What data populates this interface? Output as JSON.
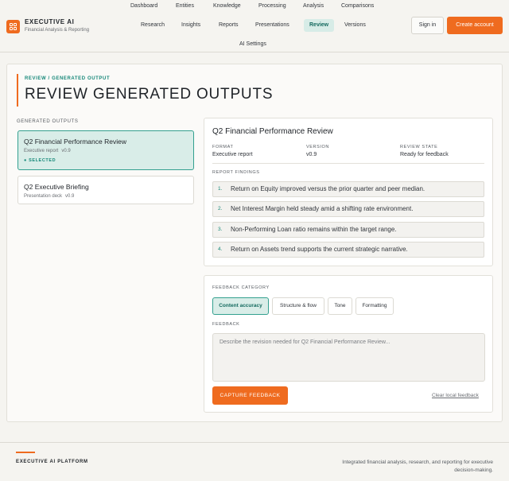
{
  "brand": {
    "name": "EXECUTIVE AI",
    "subtitle": "Financial Analysis & Reporting"
  },
  "top_nav": [
    "Dashboard",
    "Entities",
    "Knowledge",
    "Processing",
    "Analysis",
    "Comparisons"
  ],
  "main_nav": [
    "Research",
    "Insights",
    "Reports",
    "Presentations",
    "Review",
    "Versions"
  ],
  "main_nav_active": "Review",
  "settings_link": "AI Settings",
  "auth": {
    "sign_in": "Sign in",
    "create_account": "Create account"
  },
  "page": {
    "breadcrumb": "REVIEW / GENERATED OUTPUT",
    "title": "REVIEW GENERATED OUTPUTS"
  },
  "outputs": {
    "label": "GENERATED OUTPUTS",
    "items": [
      {
        "title": "Q2 Financial Performance Review",
        "type": "Executive report",
        "version": "v0.9",
        "selected_label": "SELECTED"
      },
      {
        "title": "Q2 Executive Briefing",
        "type": "Presentation deck",
        "version": "v0.9"
      }
    ]
  },
  "review": {
    "title": "Q2 Financial Performance Review",
    "meta": [
      {
        "label": "FORMAT",
        "value": "Executive report"
      },
      {
        "label": "VERSION",
        "value": "v0.9"
      },
      {
        "label": "REVIEW STATE",
        "value": "Ready for feedback"
      }
    ],
    "findings_label": "REPORT FINDINGS",
    "findings": [
      {
        "num": "1.",
        "text": "Return on Equity improved versus the prior quarter and peer median."
      },
      {
        "num": "2.",
        "text": "Net Interest Margin held steady amid a shifting rate environment."
      },
      {
        "num": "3.",
        "text": "Non-Performing Loan ratio remains within the target range."
      },
      {
        "num": "4.",
        "text": "Return on Assets trend supports the current strategic narrative."
      }
    ]
  },
  "feedback": {
    "category_label": "FEEDBACK CATEGORY",
    "categories": [
      "Content accuracy",
      "Structure & flow",
      "Tone",
      "Formatting"
    ],
    "active_category": "Content accuracy",
    "feedback_label": "FEEDBACK",
    "placeholder": "Describe the revision needed for Q2 Financial Performance Review...",
    "value": "",
    "capture_label": "CAPTURE FEEDBACK",
    "clear_label": "Clear local feedback"
  },
  "footer": {
    "brand": "EXECUTIVE AI PLATFORM",
    "description": "Integrated financial analysis, research, and reporting for executive decision-making."
  },
  "colors": {
    "accent": "#ef6b1f",
    "teal": "#18897a",
    "teal_bg": "#d9ede8"
  }
}
